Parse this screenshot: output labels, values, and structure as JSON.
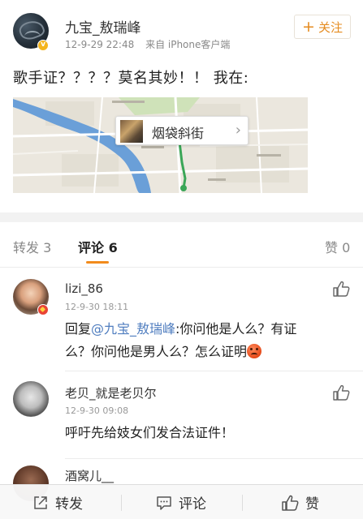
{
  "post": {
    "author": "九宝_敖瑞峰",
    "timestamp": "12-9-29 22:48",
    "source": "来自 iPhone客户端",
    "follow_label": "关注",
    "text": "歌手证？？？？莫名其妙！！ 我在:",
    "location": "烟袋斜街"
  },
  "tabs": {
    "repost": "转发 3",
    "comment": "评论 6",
    "like": "赞 0"
  },
  "comments": [
    {
      "name": "lizi_86",
      "time": "12-9-30 18:11",
      "reply_prefix": "回复",
      "mention": "@九宝_敖瑞峰",
      "text_line1_rest": ":你问他是人么？有证",
      "text_line2": "么？你问他是男人么？怎么证明"
    },
    {
      "name": "老贝_就是老贝尔",
      "time": "12-9-30 09:08",
      "text": "呼吁先给妓女们发合法证件！"
    },
    {
      "name": "酒窝儿__"
    }
  ],
  "bottom_bar": {
    "repost": "转发",
    "comment": "评论",
    "like": "赞"
  },
  "colors": {
    "accent_orange": "#f28b1c",
    "mention_blue": "#4f7dbf",
    "verified_yellow": "#f4b51f"
  },
  "icons": [
    "verified-badge-icon",
    "plus-icon",
    "chevron-right-icon",
    "thumbs-up-icon",
    "share-icon",
    "comment-icon",
    "angry-emoji-icon"
  ]
}
